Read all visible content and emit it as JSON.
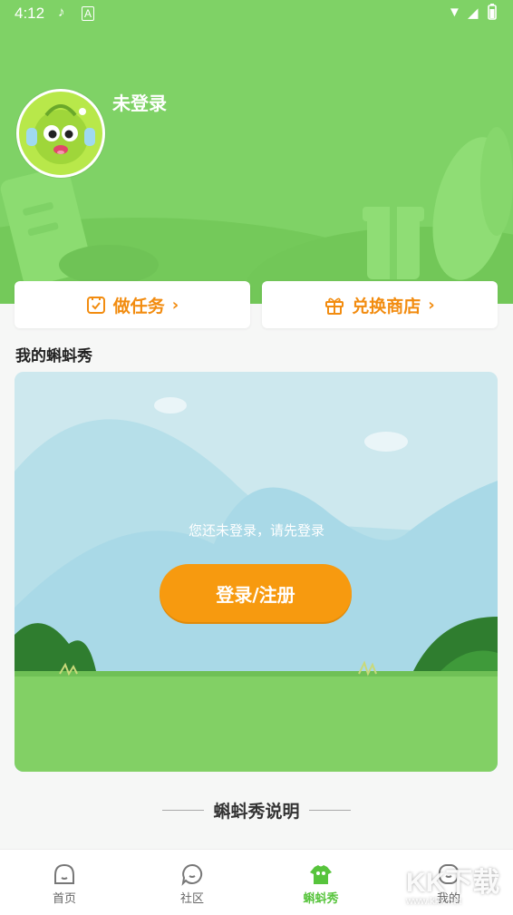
{
  "status_bar": {
    "time": "4:12",
    "icons": [
      "music-note-icon",
      "notification-a-icon",
      "wifi-icon",
      "signal-icon",
      "battery-icon"
    ]
  },
  "profile": {
    "name": "未登录"
  },
  "actions": [
    {
      "label": "做任务",
      "icon": "task-check-icon"
    },
    {
      "label": "兑换商店",
      "icon": "gift-icon"
    }
  ],
  "show": {
    "title": "我的蝌蚪秀",
    "notice": "您还未登录，请先登录",
    "login_button": "登录/注册"
  },
  "explain": {
    "title": "蝌蚪秀说明"
  },
  "tabs": [
    {
      "label": "首页",
      "icon": "home-icon",
      "active": false
    },
    {
      "label": "社区",
      "icon": "community-icon",
      "active": false
    },
    {
      "label": "蝌蚪秀",
      "icon": "tadpole-show-icon",
      "active": true
    },
    {
      "label": "我的",
      "icon": "profile-icon",
      "active": false
    }
  ],
  "watermark": {
    "text": "KK下载",
    "url": "www.kkx.net"
  },
  "colors": {
    "header": "#7fd266",
    "accent_orange": "#f79a0f",
    "active_tab": "#57c43c"
  }
}
